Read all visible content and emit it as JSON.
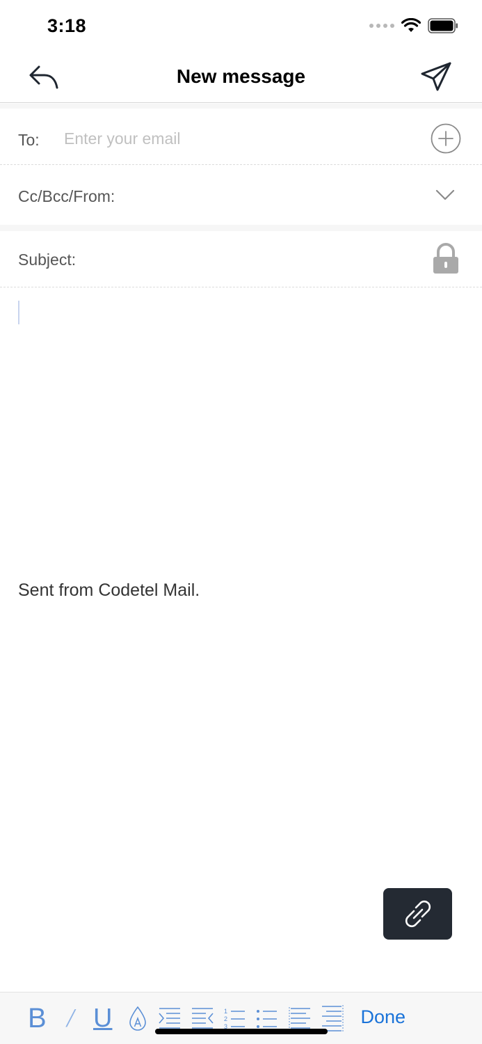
{
  "status_bar": {
    "time": "3:18"
  },
  "nav": {
    "title": "New message"
  },
  "to_field": {
    "label": "To:",
    "placeholder": "Enter your email",
    "value": ""
  },
  "cc_field": {
    "label": "Cc/Bcc/From:"
  },
  "subject_field": {
    "label": "Subject:",
    "value": ""
  },
  "body": {
    "signature": "Sent from Codetel Mail."
  },
  "toolbar": {
    "bold_label": "B",
    "italic_label": "/",
    "underline_label": "U",
    "done_label": "Done",
    "icons": [
      "font-color-icon",
      "indent-icon",
      "outdent-icon",
      "numbered-list-icon",
      "bullet-list-icon",
      "align-left-icon",
      "align-right-icon"
    ]
  },
  "colors": {
    "accent": "#1a73d9",
    "format_icons": "#5b8fd6",
    "attach_bg": "#242a33"
  }
}
